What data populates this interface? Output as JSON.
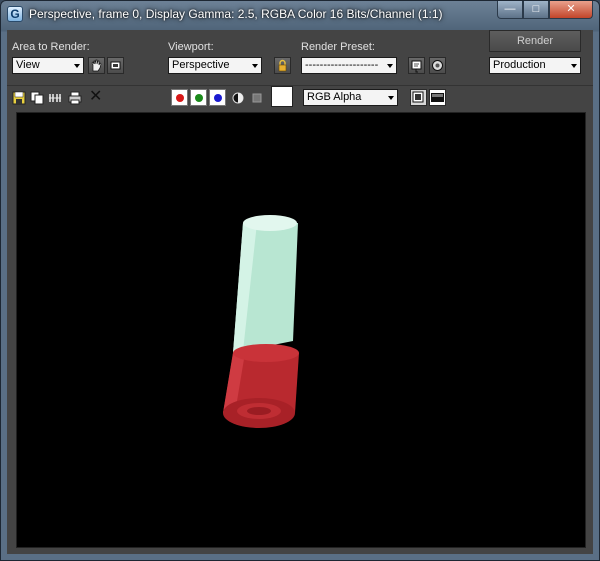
{
  "window": {
    "title": "Perspective, frame 0, Display Gamma: 2.5, RGBA Color 16 Bits/Channel (1:1)",
    "app_icon_glyph": "G",
    "minimize_glyph": "—",
    "maximize_glyph": "□",
    "close_glyph": "✕"
  },
  "controls": {
    "area_label": "Area to Render:",
    "area_value": "View",
    "viewport_label": "Viewport:",
    "viewport_value": "Perspective",
    "preset_label": "Render Preset:",
    "preset_value": "--------------------",
    "render_label": "Render",
    "mode_value": "Production"
  },
  "toolbar": {
    "channel_value": "RGB Alpha",
    "delete_glyph": "✕"
  },
  "colors": {
    "red_channel": "#d81818",
    "green_channel": "#1a8a1a",
    "blue_channel": "#1a1ad0",
    "cylinder_top": "#c8eedd",
    "cylinder_bottom": "#c0303a"
  },
  "icons": [
    "pan-hand-icon",
    "region-icon",
    "lock-icon",
    "preset-load-icon",
    "preset-save-icon",
    "save-icon",
    "copy-icon",
    "clone-icon",
    "print-icon",
    "clear-icon",
    "mono-icon",
    "swatch-icon",
    "frame-buffer-icon",
    "toggle-ui-icon"
  ]
}
